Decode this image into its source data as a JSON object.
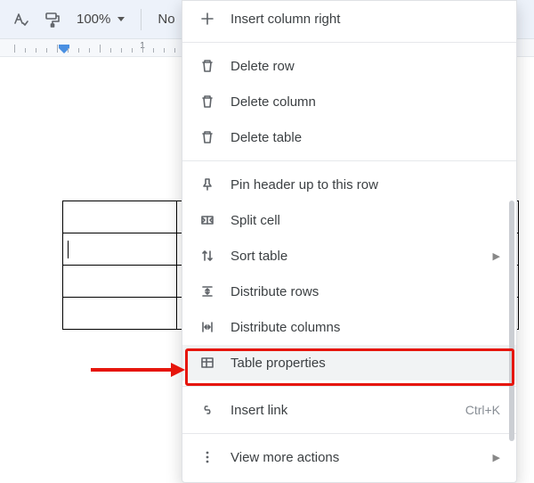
{
  "toolbar": {
    "zoom": "100%",
    "style": "No"
  },
  "ruler": {
    "label1": "1"
  },
  "menu": {
    "insert_col_right": "Insert column right",
    "delete_row": "Delete row",
    "delete_column": "Delete column",
    "delete_table": "Delete table",
    "pin_header": "Pin header up to this row",
    "split_cell": "Split cell",
    "sort_table": "Sort table",
    "distribute_rows": "Distribute rows",
    "distribute_cols": "Distribute columns",
    "table_props": "Table properties",
    "insert_link": "Insert link",
    "insert_link_shortcut": "Ctrl+K",
    "view_more": "View more actions"
  }
}
